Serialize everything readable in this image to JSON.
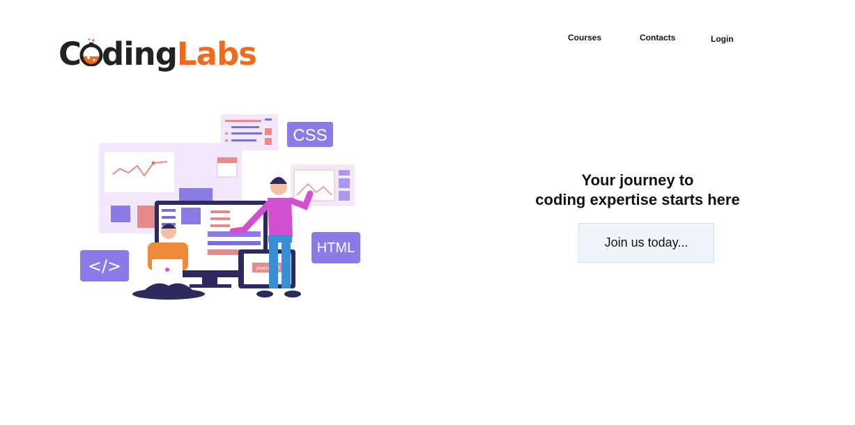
{
  "brand": {
    "part1": "C",
    "part2": "ding",
    "part3": "Labs",
    "accent_color": "#ef6a1b",
    "dark_color": "#222222"
  },
  "nav": {
    "courses": "Courses",
    "contacts": "Contacts",
    "login": "Login"
  },
  "hero": {
    "headline_line1": "Your journey to",
    "headline_line2": "coding expertise starts here",
    "cta": "Join us today...",
    "illustration": {
      "css_badge": "CSS",
      "html_badge": "HTML",
      "code_badge": "</>",
      "tablet_label": "JAVASCRIPT"
    }
  }
}
